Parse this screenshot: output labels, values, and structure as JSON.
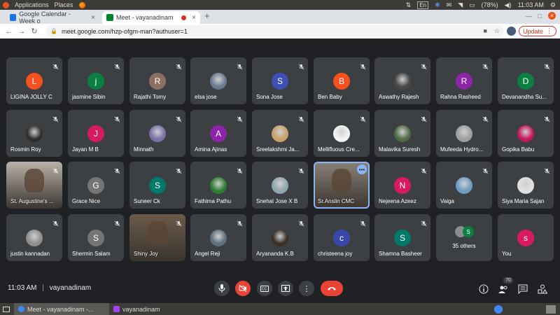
{
  "os": {
    "menu": [
      "Applications",
      "Places"
    ],
    "lang": "En",
    "battery": "(78%)",
    "time": "11:03 AM"
  },
  "tabs": [
    {
      "title": "Google Calendar - Week o",
      "active": false
    },
    {
      "title": "Meet - vayanadinam",
      "active": true
    }
  ],
  "browser": {
    "url": "meet.google.com/hzp-ofgm-man?authuser=1",
    "update_label": "Update"
  },
  "participants": [
    {
      "name": "LIGINA JOLLY C",
      "initial": "L",
      "color": "#f4511e"
    },
    {
      "name": "jasmine Sibin",
      "initial": "j",
      "color": "#0b8043"
    },
    {
      "name": "Rajathi Tomy",
      "initial": "R",
      "color": "#8d6e63"
    },
    {
      "name": "elsa jose",
      "initial": "",
      "color": "#5f6368",
      "photo": "#6b7a8f"
    },
    {
      "name": "Sona Jose",
      "initial": "S",
      "color": "#3f51b5"
    },
    {
      "name": "Ben Baby",
      "initial": "B",
      "color": "#f4511e"
    },
    {
      "name": "Aswathy Rajesh",
      "initial": "",
      "color": "#5f6368",
      "photo": "#4a4a4a"
    },
    {
      "name": "Rahna Rasheed",
      "initial": "R",
      "color": "#8e24aa"
    },
    {
      "name": "Devanandha Su...",
      "initial": "D",
      "color": "#0b8043"
    },
    {
      "name": "Rosmin Roy",
      "initial": "",
      "color": "#5f6368",
      "photo": "#2d2d2d"
    },
    {
      "name": "Jayan M B",
      "initial": "J",
      "color": "#d81b60"
    },
    {
      "name": "Minnath",
      "initial": "",
      "color": "#5f6368",
      "photo": "#7b6fa8"
    },
    {
      "name": "Amina Ajinas",
      "initial": "A",
      "color": "#8e24aa"
    },
    {
      "name": "Sreelakshmi Ja...",
      "initial": "",
      "color": "#5f6368",
      "photo": "#c9a06a"
    },
    {
      "name": "Mellifluous Cre...",
      "initial": "",
      "color": "#5f6368",
      "photo": "#f5f5f5"
    },
    {
      "name": "Malavika Suresh",
      "initial": "",
      "color": "#5f6368",
      "photo": "#4e6b45"
    },
    {
      "name": "Mufeeda Hydro...",
      "initial": "",
      "color": "#5f6368",
      "photo": "#9e9e9e"
    },
    {
      "name": "Gopika Babu",
      "initial": "",
      "color": "#5f6368",
      "photo": "#c2185b"
    },
    {
      "name": "St. Augustine's ...",
      "initial": "",
      "color": "#5f6368",
      "video": "#b8b2a8"
    },
    {
      "name": "Grace Nice",
      "initial": "G",
      "color": "#757575"
    },
    {
      "name": "Suneer Ck",
      "initial": "S",
      "color": "#00796b"
    },
    {
      "name": "Fathima Pathu",
      "initial": "",
      "color": "#5f6368",
      "photo": "#2e7d32"
    },
    {
      "name": "Snehal Jose X B",
      "initial": "",
      "color": "#5f6368",
      "photo": "#90a4ae"
    },
    {
      "name": "Sr.Anslin CMC",
      "initial": "",
      "color": "#5f6368",
      "video": "#8a8176"
    },
    {
      "name": "Nejeena Azeez",
      "initial": "N",
      "color": "#d81b60"
    },
    {
      "name": "Vaiga",
      "initial": "",
      "color": "#5f6368",
      "photo": "#6d9bc3"
    },
    {
      "name": "Siya Maria Sajan",
      "initial": "",
      "color": "#5f6368",
      "photo": "#e0e0e0"
    },
    {
      "name": "justin kannadan",
      "initial": "",
      "color": "#5f6368",
      "photo": "#8d8d8d"
    },
    {
      "name": "Shermin Salam",
      "initial": "S",
      "color": "#757575"
    },
    {
      "name": "Shiny Joy",
      "initial": "",
      "color": "#5f6368",
      "video": "#6b5a4a"
    },
    {
      "name": "Angel Reji",
      "initial": "",
      "color": "#5f6368",
      "photo": "#5c6f7e"
    },
    {
      "name": "Aryananda K.B",
      "initial": "",
      "color": "#5f6368",
      "photo": "#3a2e28"
    },
    {
      "name": "christeena joy",
      "initial": "c",
      "color": "#3949ab"
    },
    {
      "name": "Shamna Basheer",
      "initial": "S",
      "color": "#00796b"
    },
    {
      "name": "35 others",
      "initial": "S",
      "color": "#0b8043",
      "others": true
    },
    {
      "name": "You",
      "initial": "s",
      "color": "#d81b60"
    }
  ],
  "meeting": {
    "time": "11:03 AM",
    "separator": "|",
    "code": "vayanadinam",
    "people_count": "70"
  },
  "taskbar": [
    {
      "title": "Meet - vayanadinam -...",
      "active": true
    },
    {
      "title": "vayanadinam",
      "active": false
    }
  ]
}
